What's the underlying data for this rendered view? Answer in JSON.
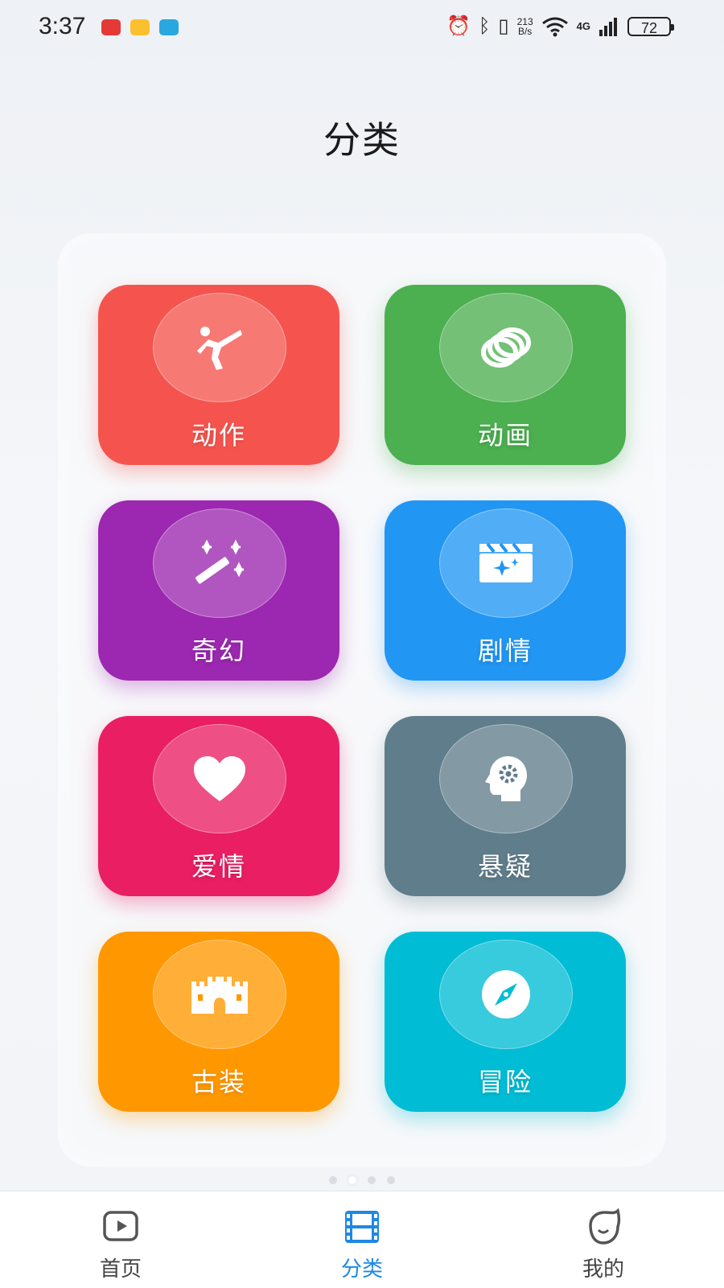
{
  "status_bar": {
    "time": "3:37",
    "net_speed_top": "213",
    "net_speed_bottom": "B/s",
    "network": "4G",
    "battery": "72"
  },
  "page": {
    "title": "分类"
  },
  "categories": [
    {
      "label": "动作",
      "icon": "martial-arts-kick-icon",
      "color": "#f5544e"
    },
    {
      "label": "动画",
      "icon": "rings-icon",
      "color": "#4caf50"
    },
    {
      "label": "奇幻",
      "icon": "magic-wand-icon",
      "color": "#9c27b0"
    },
    {
      "label": "剧情",
      "icon": "clapperboard-icon",
      "color": "#2196f3"
    },
    {
      "label": "爱情",
      "icon": "heart-icon",
      "color": "#e91e63"
    },
    {
      "label": "悬疑",
      "icon": "head-gear-icon",
      "color": "#607d8b"
    },
    {
      "label": "古装",
      "icon": "castle-icon",
      "color": "#ff9800"
    },
    {
      "label": "冒险",
      "icon": "compass-icon",
      "color": "#00bcd4"
    }
  ],
  "tabbar": {
    "items": [
      {
        "label": "首页",
        "icon": "home-play-icon"
      },
      {
        "label": "分类",
        "icon": "film-icon",
        "active": true
      },
      {
        "label": "我的",
        "icon": "profile-face-icon"
      }
    ],
    "active_color": "#1e88e5"
  }
}
